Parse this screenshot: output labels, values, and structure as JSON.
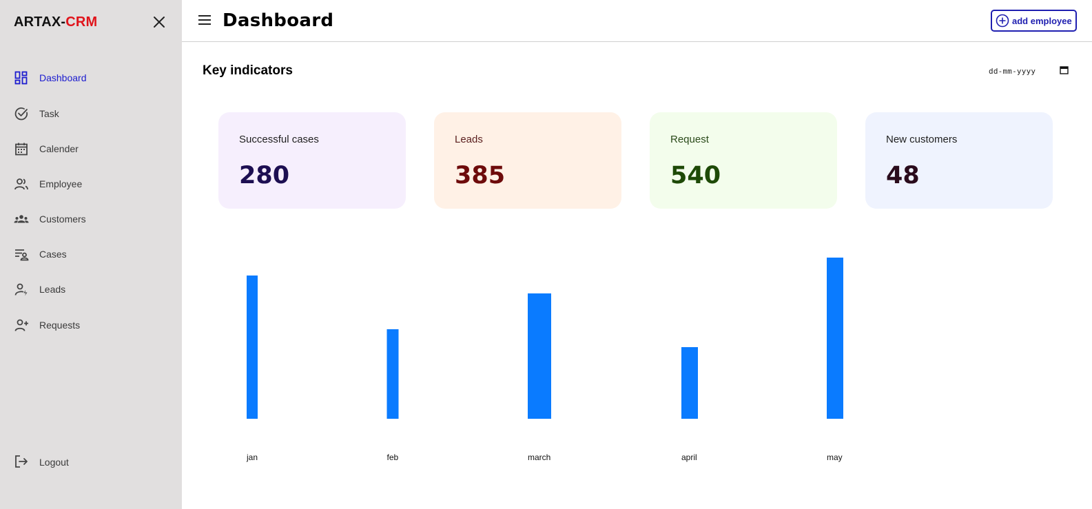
{
  "brand": {
    "part1": "ARTAX-",
    "part2": "CRM"
  },
  "sidebar": {
    "items": [
      {
        "label": "Dashboard",
        "icon": "dashboard-icon",
        "active": true
      },
      {
        "label": "Task",
        "icon": "check-circle-icon"
      },
      {
        "label": "Calender",
        "icon": "calendar-icon"
      },
      {
        "label": "Employee",
        "icon": "people-icon"
      },
      {
        "label": "Customers",
        "icon": "groups-icon"
      },
      {
        "label": "Cases",
        "icon": "cases-icon"
      },
      {
        "label": "Leads",
        "icon": "person-bolt-icon"
      },
      {
        "label": "Requests",
        "icon": "person-add-icon"
      }
    ],
    "logout_label": "Logout"
  },
  "header": {
    "title": "Dashboard",
    "add_button_label": "add employee"
  },
  "main": {
    "section_title": "Key indicators",
    "date_placeholder": "dd-mm-yyyy"
  },
  "cards": [
    {
      "label": "Successful cases",
      "value": "280",
      "bg": "#f6effd",
      "label_color": "#1f1f1f",
      "value_color": "#1d0f52"
    },
    {
      "label": "Leads",
      "value": "385",
      "bg": "#fff1e6",
      "label_color": "#5a1e1e",
      "value_color": "#6e0b0b"
    },
    {
      "label": "Request",
      "value": "540",
      "bg": "#f3fdec",
      "label_color": "#2a4a1a",
      "value_color": "#1e4a07"
    },
    {
      "label": "New customers",
      "value": "48",
      "bg": "#eff3fe",
      "label_color": "#1f1f1f",
      "value_color": "#2a0b1c"
    }
  ],
  "colors": {
    "accent": "#1c1ccf",
    "bar": "#0a7bff",
    "brand_red": "#e0141b"
  },
  "chart_data": {
    "type": "bar",
    "categories": [
      "jan",
      "feb",
      "march",
      "april",
      "may"
    ],
    "values": [
      80,
      50,
      70,
      40,
      90
    ],
    "ylim": [
      0,
      90
    ],
    "grid": false,
    "legend": "none"
  }
}
